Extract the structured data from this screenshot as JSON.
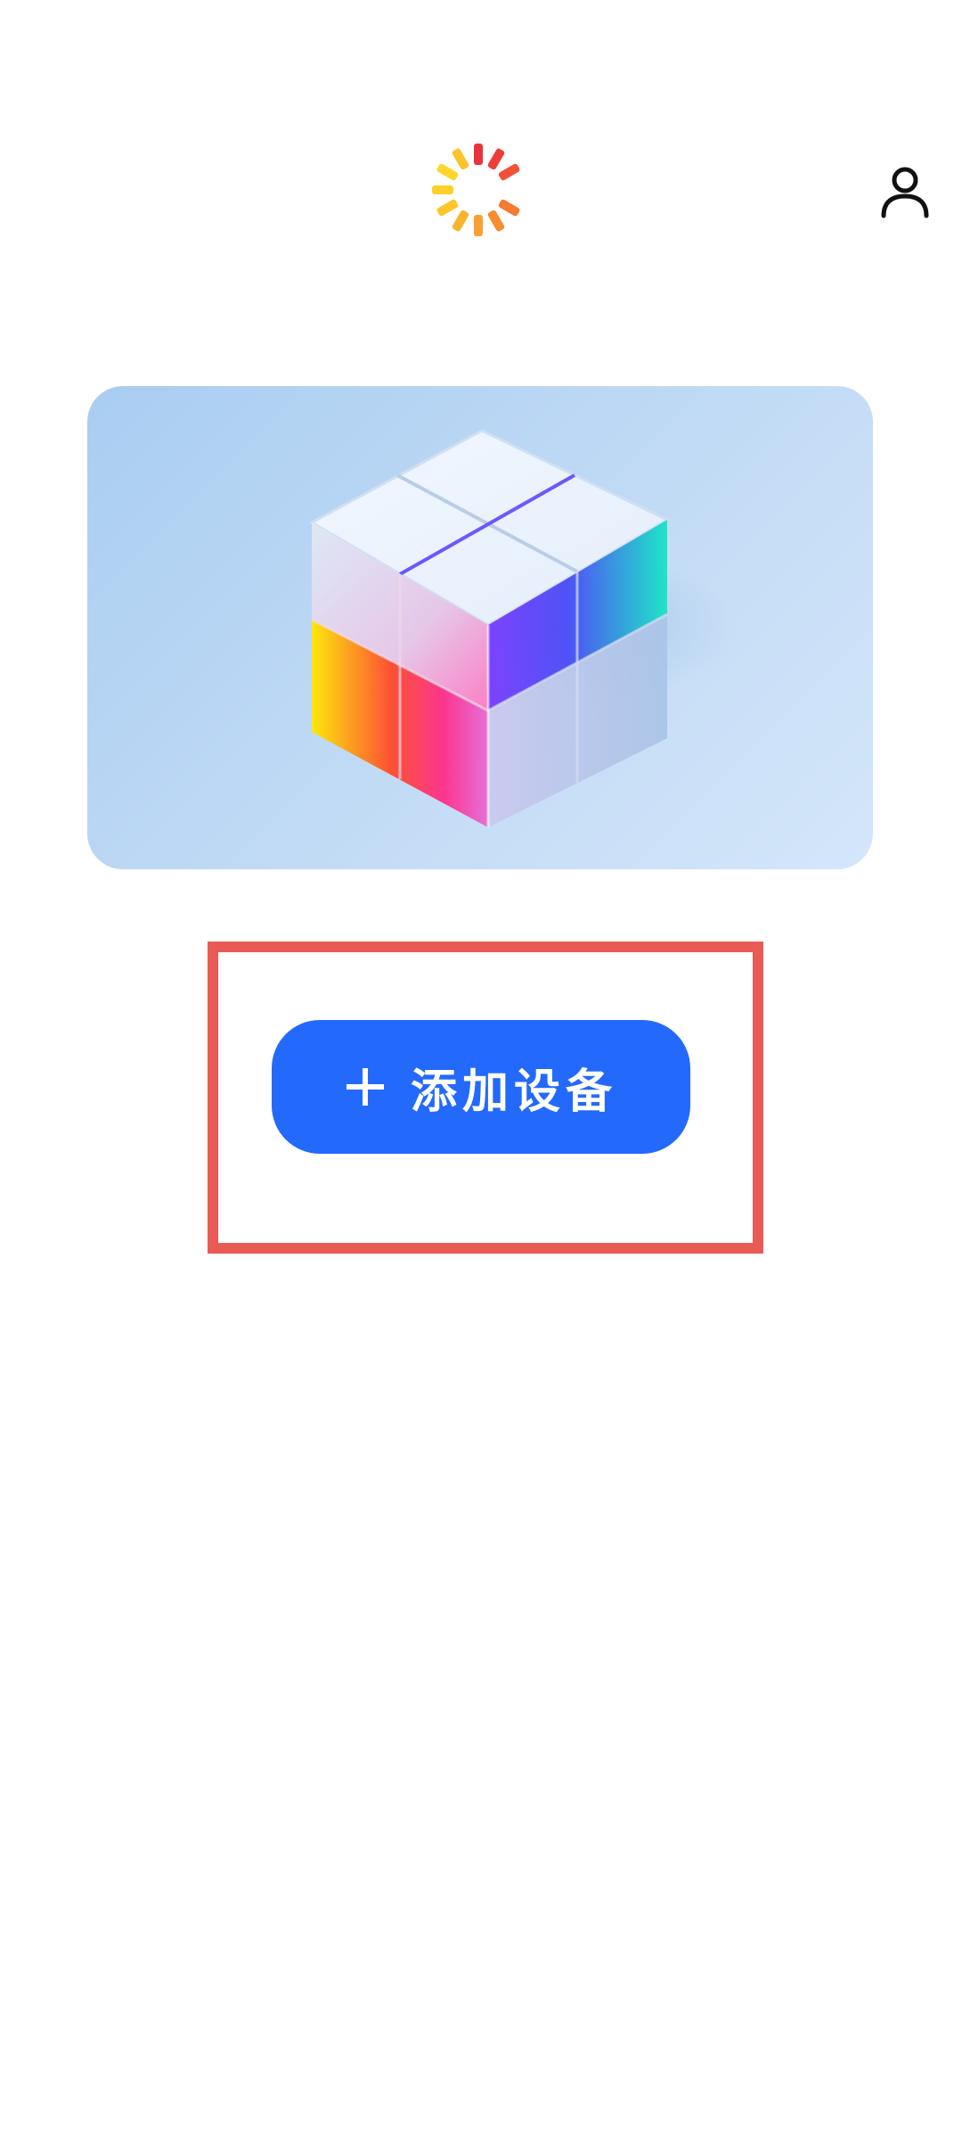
{
  "header": {
    "logo_icon": "loading-spinner-logo-icon",
    "profile_icon": "user-profile-icon"
  },
  "hero": {
    "image": "rubiks-cube-illustration"
  },
  "actions": {
    "add_device_icon": "plus-icon",
    "add_device_label": "添加设备"
  },
  "colors": {
    "primary": "#2369fc",
    "highlight": "#ea5a55",
    "hero_bg": "#c2dbf5"
  }
}
